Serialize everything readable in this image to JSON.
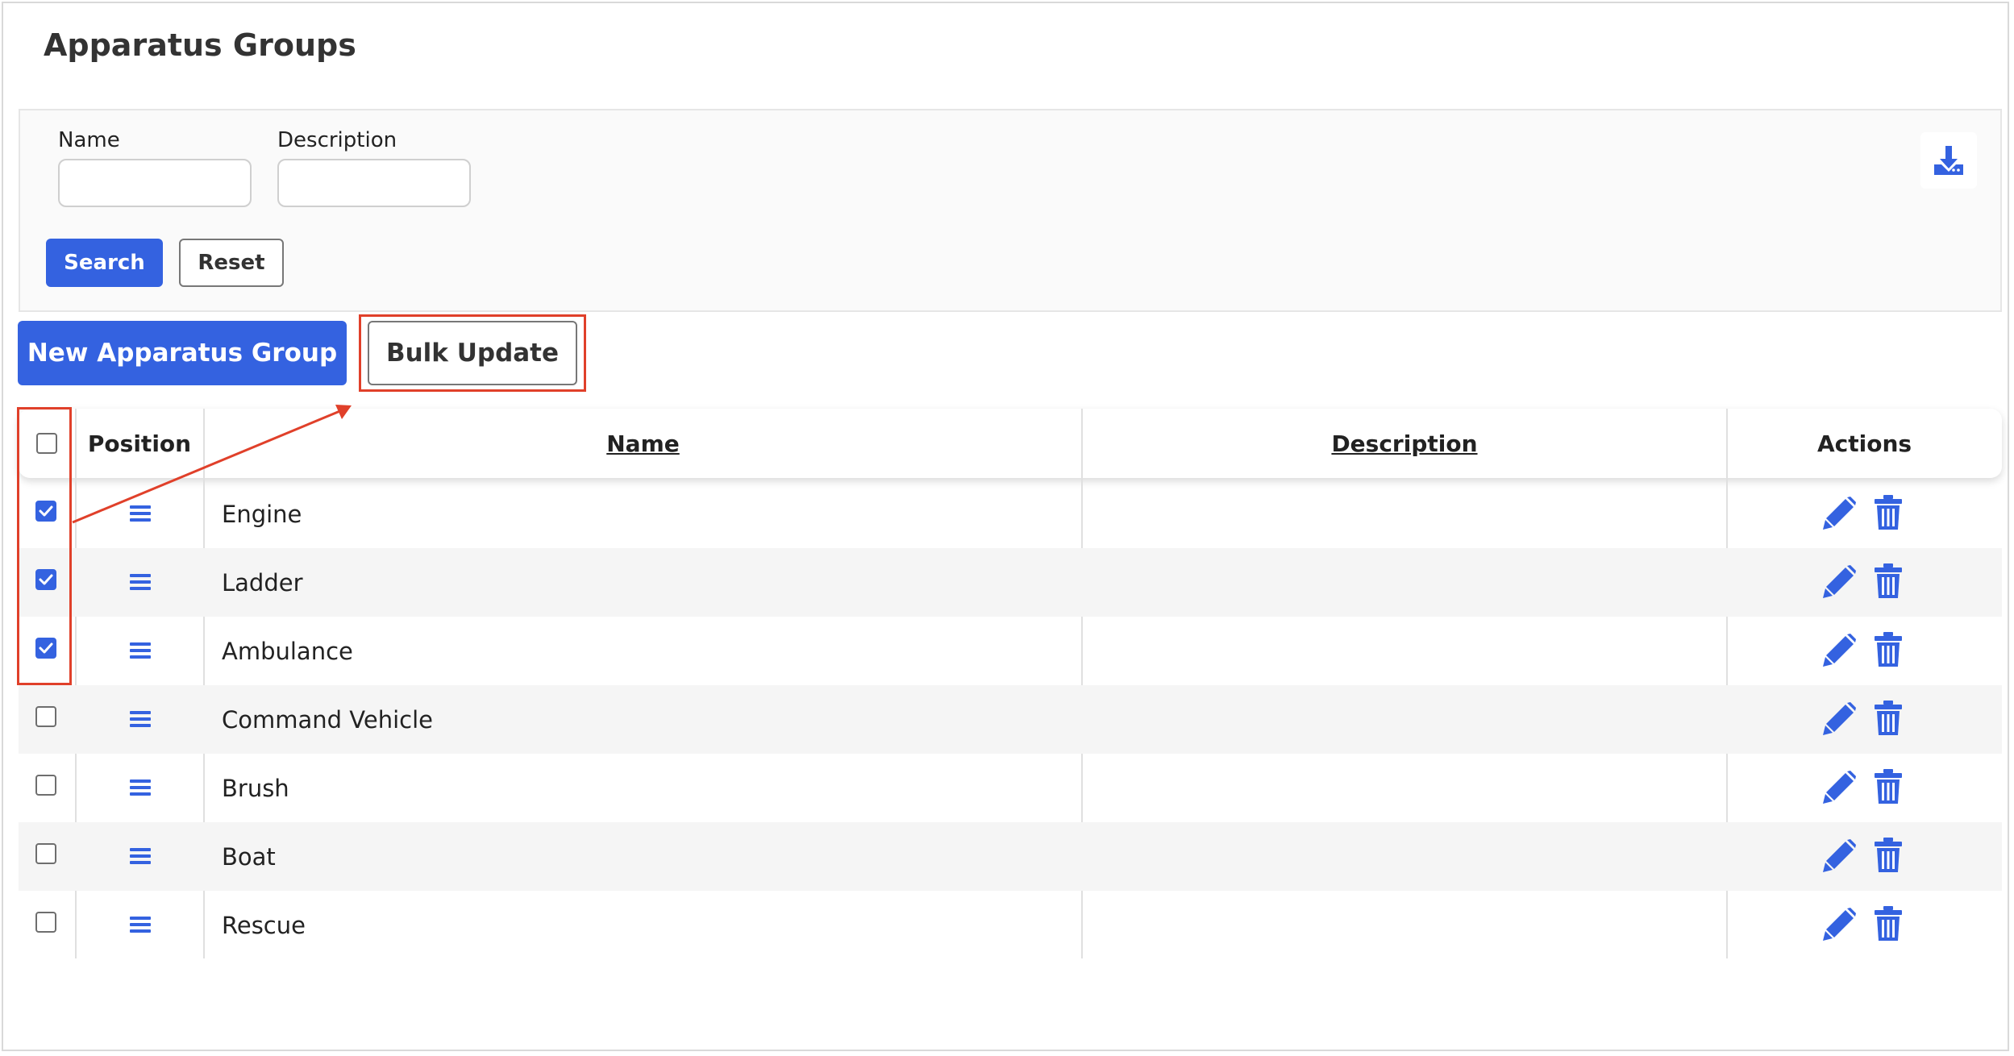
{
  "page": {
    "title": "Apparatus Groups"
  },
  "filters": {
    "name_label": "Name",
    "name_value": "",
    "description_label": "Description",
    "description_value": "",
    "search_label": "Search",
    "reset_label": "Reset",
    "download_icon": "download-icon"
  },
  "toolbar": {
    "new_label": "New Apparatus Group",
    "bulk_label": "Bulk Update"
  },
  "table": {
    "columns": {
      "position": "Position",
      "name": "Name",
      "description": "Description",
      "actions": "Actions"
    },
    "select_all_checked": false,
    "rows": [
      {
        "name": "Engine",
        "description": "",
        "checked": true
      },
      {
        "name": "Ladder",
        "description": "",
        "checked": true
      },
      {
        "name": "Ambulance",
        "description": "",
        "checked": true
      },
      {
        "name": "Command Vehicle",
        "description": "",
        "checked": false
      },
      {
        "name": "Brush",
        "description": "",
        "checked": false
      },
      {
        "name": "Boat",
        "description": "",
        "checked": false
      },
      {
        "name": "Rescue",
        "description": "",
        "checked": false
      }
    ]
  },
  "colors": {
    "accent": "#3462e0",
    "annotation": "#e0402a"
  }
}
